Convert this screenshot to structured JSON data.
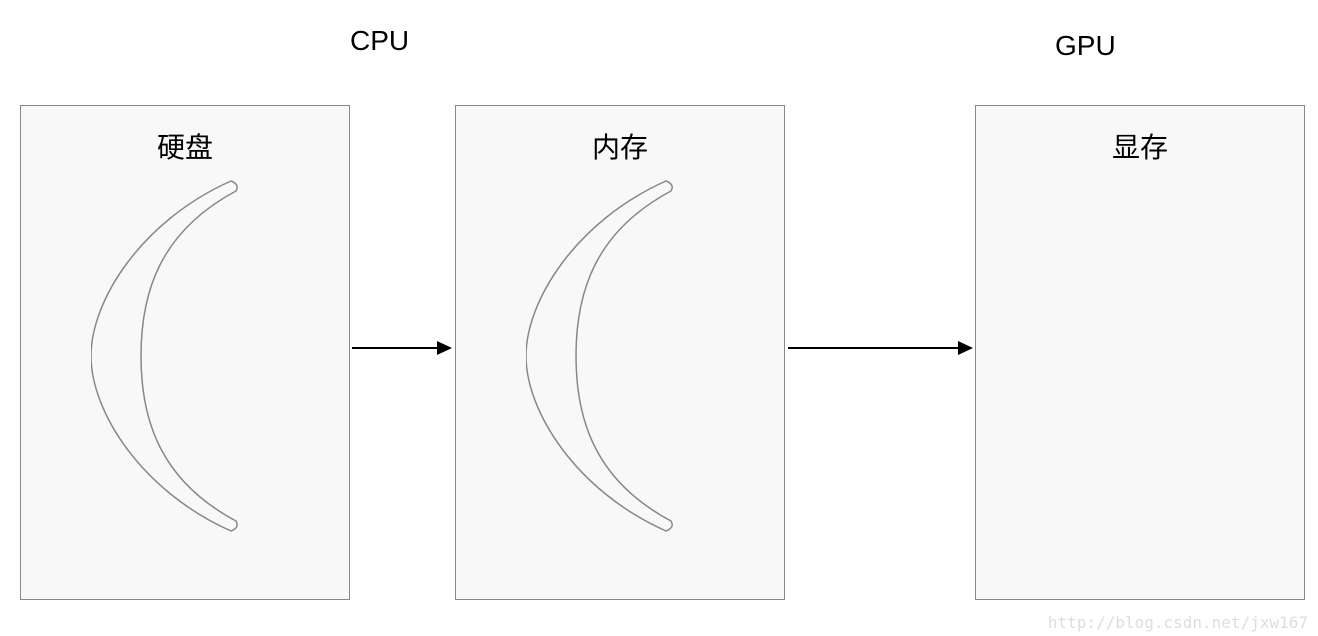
{
  "headers": {
    "cpu": "CPU",
    "gpu": "GPU"
  },
  "boxes": {
    "disk": "硬盘",
    "memory": "内存",
    "vram": "显存"
  },
  "watermark": "http://blog.csdn.net/jxw167"
}
